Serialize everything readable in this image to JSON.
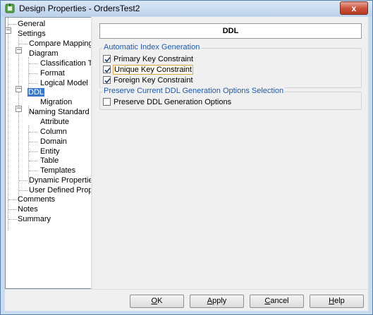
{
  "window": {
    "title": "Design Properties - OrdersTest2",
    "close_glyph": "x"
  },
  "tree": {
    "items": [
      {
        "label": "General",
        "expander": ""
      },
      {
        "label": "Settings",
        "expander": "−"
      },
      {
        "label": "Compare Mappings",
        "expander": ""
      },
      {
        "label": "Diagram",
        "expander": "−"
      },
      {
        "label": "Classification Type",
        "expander": ""
      },
      {
        "label": "Format",
        "expander": ""
      },
      {
        "label": "Logical Model",
        "expander": ""
      },
      {
        "label": "DDL",
        "expander": "−",
        "selected": true
      },
      {
        "label": "Migration",
        "expander": ""
      },
      {
        "label": "Naming Standard",
        "expander": "−"
      },
      {
        "label": "Attribute",
        "expander": ""
      },
      {
        "label": "Column",
        "expander": ""
      },
      {
        "label": "Domain",
        "expander": ""
      },
      {
        "label": "Entity",
        "expander": ""
      },
      {
        "label": "Table",
        "expander": ""
      },
      {
        "label": "Templates",
        "expander": ""
      },
      {
        "label": "Dynamic Properties",
        "expander": ""
      },
      {
        "label": "User Defined Properties",
        "expander": ""
      },
      {
        "label": "Comments",
        "expander": ""
      },
      {
        "label": "Notes",
        "expander": ""
      },
      {
        "label": "Summary",
        "expander": ""
      }
    ]
  },
  "panel": {
    "header": "DDL",
    "group1": {
      "title": "Automatic Index Generation",
      "options": [
        {
          "label": "Primary Key Constraint",
          "checked": true
        },
        {
          "label": "Unique Key Constraint",
          "checked": true
        },
        {
          "label": "Foreign Key Constraint",
          "checked": true
        }
      ]
    },
    "group2": {
      "title": "Preserve Current DDL Generation Options Selection",
      "options": [
        {
          "label": "Preserve DDL Generation Options",
          "checked": false
        }
      ]
    }
  },
  "buttons": {
    "ok": {
      "mnemonic": "O",
      "rest": "K"
    },
    "apply": {
      "mnemonic": "A",
      "rest": "pply"
    },
    "cancel": {
      "mnemonic": "C",
      "rest": "ancel"
    },
    "help": {
      "mnemonic": "H",
      "rest": "elp"
    }
  }
}
